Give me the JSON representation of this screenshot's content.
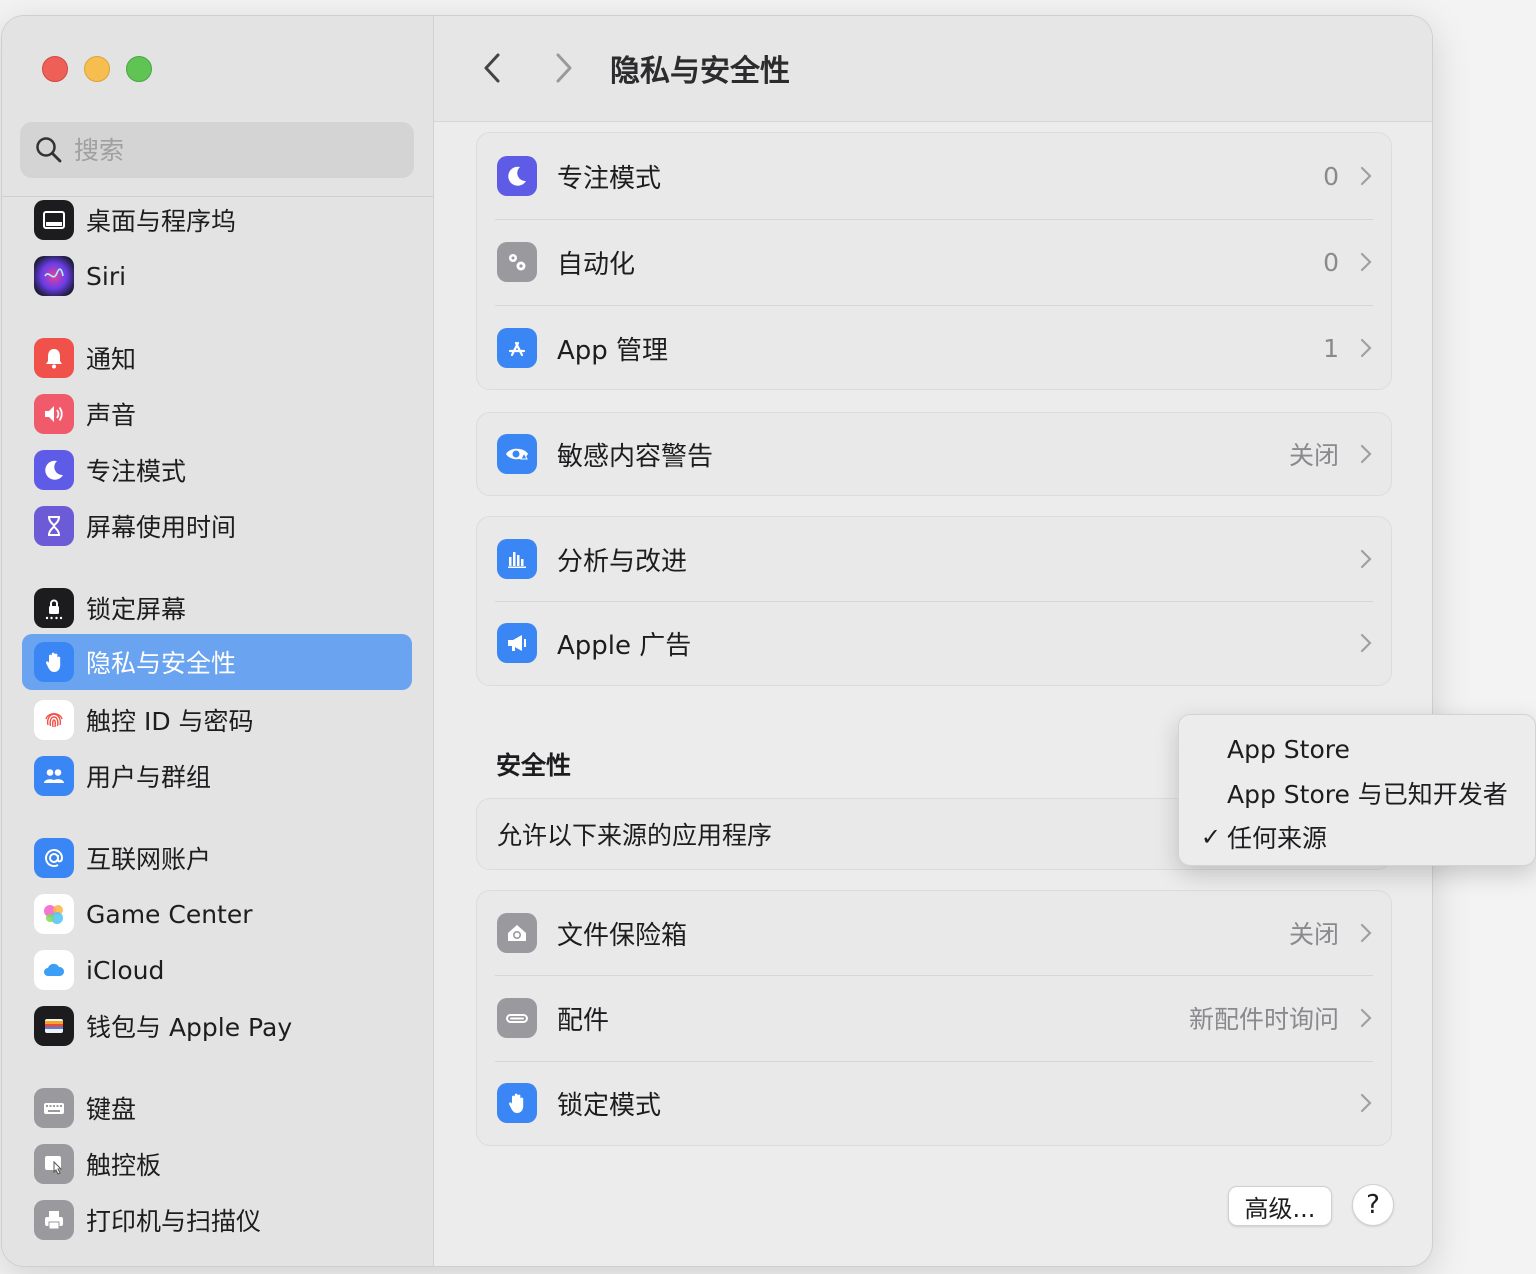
{
  "window": {
    "title": "隐私与安全性"
  },
  "search": {
    "placeholder": "搜索"
  },
  "sidebar": {
    "items": [
      {
        "label": "桌面与程序坞",
        "icon": "dock-icon",
        "color": "#1c1c1e"
      },
      {
        "label": "Siri",
        "icon": "siri-icon",
        "color": "#3b2a6b"
      },
      {
        "label": "通知",
        "icon": "bell-icon",
        "color": "#f0514a"
      },
      {
        "label": "声音",
        "icon": "speaker-icon",
        "color": "#f05a6b"
      },
      {
        "label": "专注模式",
        "icon": "moon-icon",
        "color": "#5e5ce6"
      },
      {
        "label": "屏幕使用时间",
        "icon": "hourglass-icon",
        "color": "#6b5bd6"
      },
      {
        "label": "锁定屏幕",
        "icon": "lock-icon",
        "color": "#1c1c1e"
      },
      {
        "label": "隐私与安全性",
        "icon": "hand-icon",
        "color": "#3a86f4",
        "active": true
      },
      {
        "label": "触控 ID 与密码",
        "icon": "fingerprint-icon",
        "color": "#ffffff"
      },
      {
        "label": "用户与群组",
        "icon": "users-icon",
        "color": "#3a86f4"
      },
      {
        "label": "互联网账户",
        "icon": "at-icon",
        "color": "#3a86f4"
      },
      {
        "label": "Game Center",
        "icon": "game-center-icon",
        "color": "#ffffff"
      },
      {
        "label": "iCloud",
        "icon": "cloud-icon",
        "color": "#ffffff"
      },
      {
        "label": "钱包与 Apple Pay",
        "icon": "wallet-icon",
        "color": "#1c1c1e"
      },
      {
        "label": "键盘",
        "icon": "keyboard-icon",
        "color": "#9a9a9e"
      },
      {
        "label": "触控板",
        "icon": "trackpad-icon",
        "color": "#9a9a9e"
      },
      {
        "label": "打印机与扫描仪",
        "icon": "printer-icon",
        "color": "#9a9a9e"
      }
    ]
  },
  "main": {
    "group1": [
      {
        "label": "专注模式",
        "value": "0",
        "icon": "moon-icon"
      },
      {
        "label": "自动化",
        "value": "0",
        "icon": "gears-icon"
      },
      {
        "label": "App 管理",
        "value": "1",
        "icon": "app-store-icon"
      }
    ],
    "group2": [
      {
        "label": "敏感内容警告",
        "value": "关闭",
        "icon": "eye-warning-icon"
      }
    ],
    "group3": [
      {
        "label": "分析与改进",
        "value": "",
        "icon": "chart-icon"
      },
      {
        "label": "Apple 广告",
        "value": "",
        "icon": "megaphone-icon"
      }
    ],
    "security_title": "安全性",
    "allow_apps_label": "允许以下来源的应用程序",
    "group5": [
      {
        "label": "文件保险箱",
        "value": "关闭",
        "icon": "house-lock-icon"
      },
      {
        "label": "配件",
        "value": "新配件时询问",
        "icon": "accessory-icon"
      },
      {
        "label": "锁定模式",
        "value": "",
        "icon": "hand-icon"
      }
    ],
    "advanced_button": "高级...",
    "help_button": "?"
  },
  "popup_menu": {
    "items": [
      {
        "label": "App Store",
        "checked": false
      },
      {
        "label": "App Store 与已知开发者",
        "checked": false
      },
      {
        "label": "任何来源",
        "checked": true
      }
    ],
    "check_glyph": "✓"
  }
}
